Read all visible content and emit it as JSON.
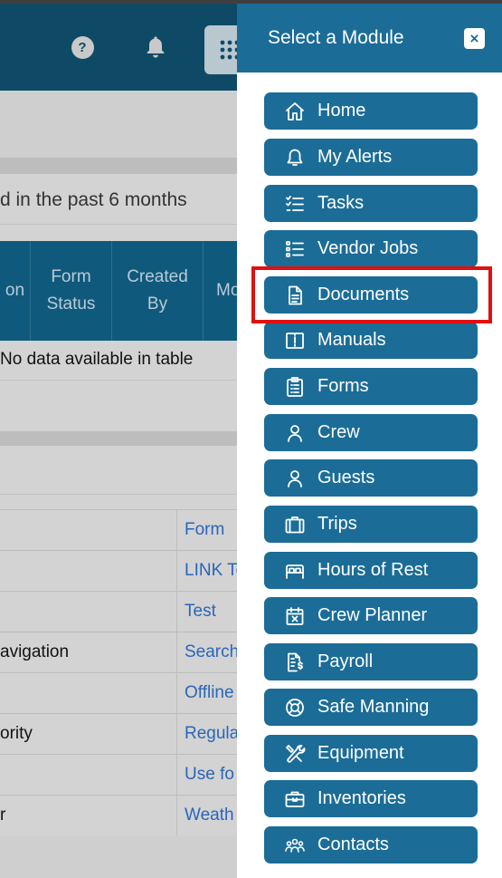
{
  "header": {
    "help_icon": "question-circle-icon",
    "help_label": "?",
    "bell_icon": "bell-icon",
    "grid_icon": "grid-icon"
  },
  "background": {
    "filter_text": "d in the past 6 months",
    "table_headers": [
      {
        "label": "on"
      },
      {
        "label": "Form\nStatus"
      },
      {
        "label": "Created\nBy"
      },
      {
        "label": "Mo"
      }
    ],
    "no_data": "No data available in table",
    "link_rows": [
      {
        "left": "",
        "right": "Form"
      },
      {
        "left": "",
        "right": "LINK To"
      },
      {
        "left": "",
        "right": "Test"
      },
      {
        "left": "avigation",
        "right": "Search"
      },
      {
        "left": "",
        "right": "Offline"
      },
      {
        "left": "ority",
        "right": "Regula"
      },
      {
        "left": "",
        "right": "Use fo"
      },
      {
        "left": "r",
        "right": "Weath"
      }
    ]
  },
  "panel": {
    "title": "Select a Module",
    "close_label": "×",
    "modules": [
      {
        "label": "Home",
        "icon": "home-icon"
      },
      {
        "label": "My Alerts",
        "icon": "bell-icon"
      },
      {
        "label": "Tasks",
        "icon": "checklist-icon"
      },
      {
        "label": "Vendor Jobs",
        "icon": "list-icon"
      },
      {
        "label": "Documents",
        "icon": "document-icon"
      },
      {
        "label": "Manuals",
        "icon": "book-icon"
      },
      {
        "label": "Forms",
        "icon": "clipboard-icon"
      },
      {
        "label": "Crew",
        "icon": "person-icon"
      },
      {
        "label": "Guests",
        "icon": "person-icon"
      },
      {
        "label": "Trips",
        "icon": "suitcase-icon"
      },
      {
        "label": "Hours of Rest",
        "icon": "bed-icon"
      },
      {
        "label": "Crew Planner",
        "icon": "calendar-x-icon"
      },
      {
        "label": "Payroll",
        "icon": "invoice-dollar-icon"
      },
      {
        "label": "Safe Manning",
        "icon": "lifebuoy-icon"
      },
      {
        "label": "Equipment",
        "icon": "tools-icon"
      },
      {
        "label": "Inventories",
        "icon": "toolbox-icon"
      },
      {
        "label": "Contacts",
        "icon": "people-group-icon"
      }
    ],
    "highlighted_module": "Documents"
  },
  "colors": {
    "panel_button": "#1b6d97",
    "header_bg": "#0e4a66",
    "highlight": "#e01010"
  }
}
